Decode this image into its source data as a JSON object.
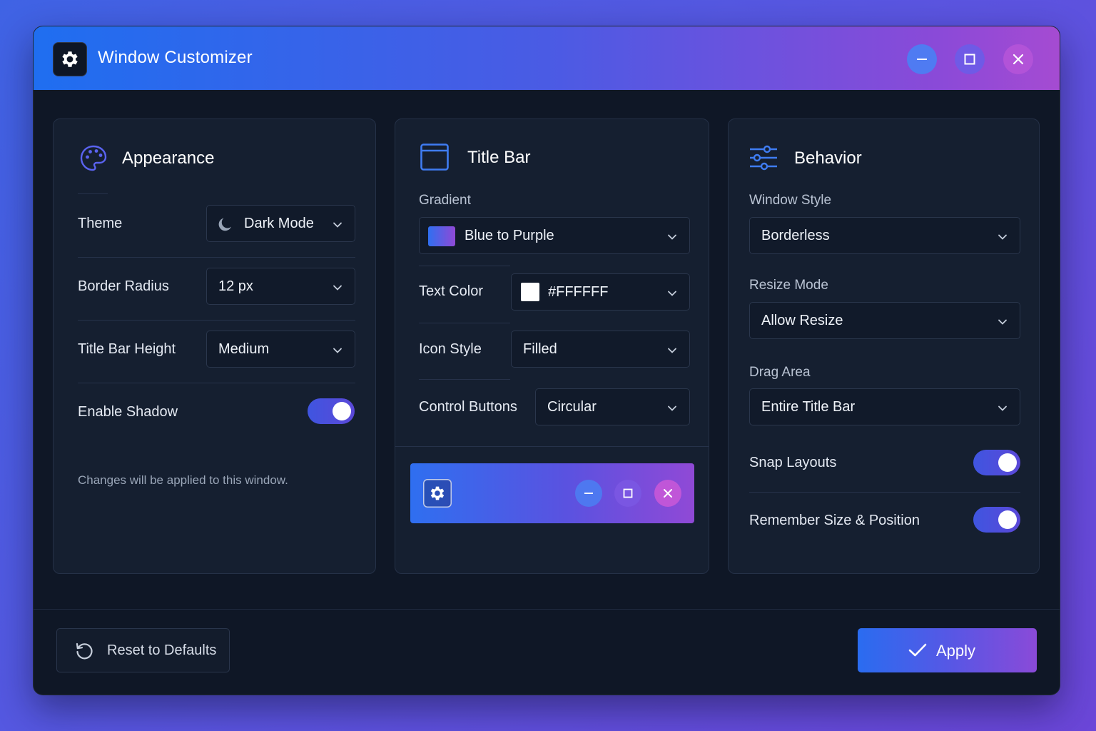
{
  "window": {
    "title": "Window Customizer"
  },
  "appearance": {
    "title": "Appearance",
    "theme_label": "Theme",
    "theme_value": "Dark Mode",
    "radius_label": "Border Radius",
    "radius_value": "12 px",
    "height_label": "Title Bar Height",
    "height_value": "Medium",
    "shadow_label": "Enable Shadow",
    "shadow_on": true,
    "note": "Changes will be applied to this window."
  },
  "titlebar": {
    "title": "Title Bar",
    "gradient_label": "Gradient",
    "gradient_value": "Blue to Purple",
    "text_color_label": "Text Color",
    "text_color_value": "#FFFFFF",
    "icon_style_label": "Icon Style",
    "icon_style_value": "Filled",
    "control_buttons_label": "Control Buttons",
    "control_buttons_value": "Circular"
  },
  "behavior": {
    "title": "Behavior",
    "window_style_label": "Window Style",
    "window_style_value": "Borderless",
    "resize_label": "Resize Mode",
    "resize_value": "Allow Resize",
    "drag_label": "Drag Area",
    "drag_value": "Entire Title Bar",
    "snap_label": "Snap Layouts",
    "snap_on": true,
    "remember_label": "Remember Size & Position",
    "remember_on": true
  },
  "footer": {
    "reset_label": "Reset to Defaults",
    "apply_label": "Apply"
  },
  "colors": {
    "accent_blue": "#1f6ef0",
    "accent_purple": "#a54bd2",
    "background": "#0f1726",
    "card": "#151f30"
  },
  "icons": {
    "app": "gear-icon",
    "appearance": "palette-icon",
    "titlebar": "window-icon",
    "behavior": "sliders-icon",
    "theme": "moon-icon",
    "reset": "refresh-icon",
    "apply": "check-icon"
  }
}
